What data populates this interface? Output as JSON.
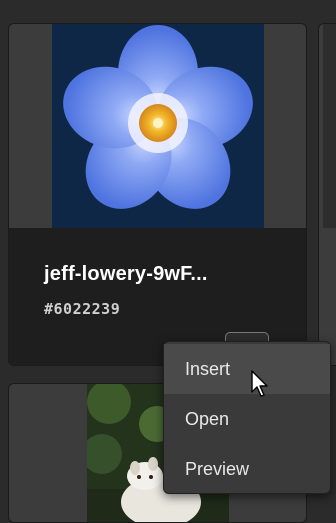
{
  "asset_card": {
    "name": "jeff-lowery-9wF...",
    "id": "#6022239"
  },
  "context_menu": {
    "items": [
      "Insert",
      "Open",
      "Preview"
    ]
  },
  "icons": {
    "more": "more-horizontal-icon",
    "cursor": "arrow-cursor-icon"
  },
  "colors": {
    "background": "#2b2b2b",
    "card": "#3c3c3c",
    "card_info": "#1e1e1e",
    "menu": "#3a3a3a",
    "menu_hover": "#4a4a4a"
  }
}
